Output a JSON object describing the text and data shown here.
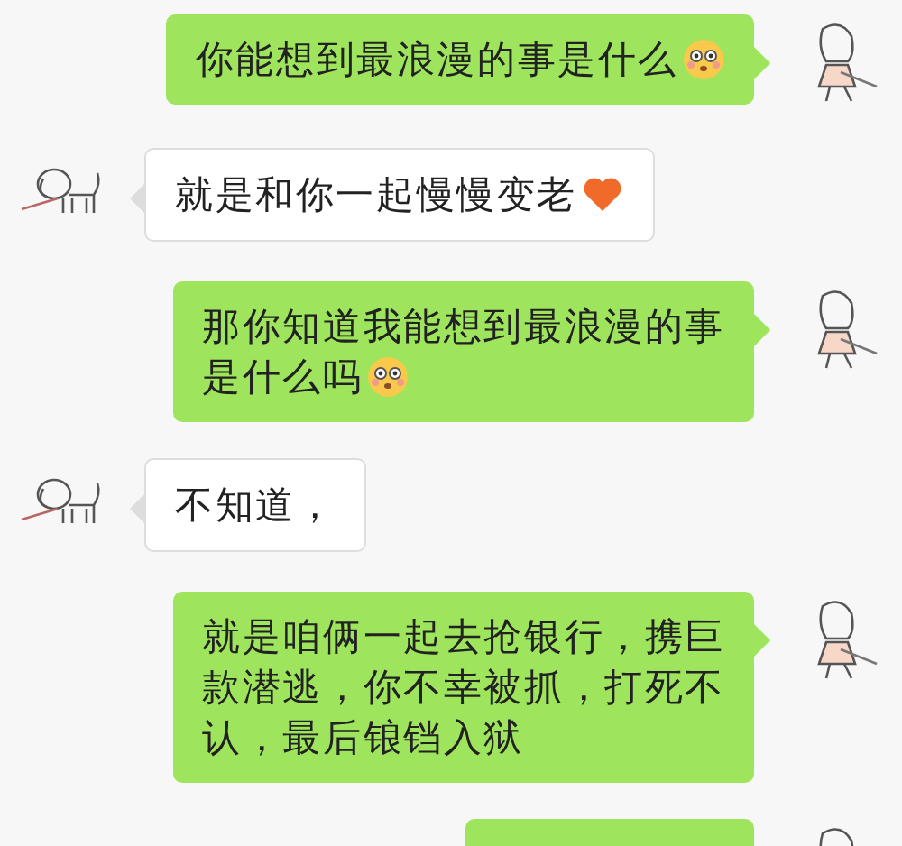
{
  "messages": [
    {
      "kind": "sent",
      "lines": [
        "你能想到最浪漫的事是什么"
      ],
      "emoji": {
        "kind": "flushed"
      }
    },
    {
      "kind": "received",
      "lines": [
        "就是和你一起慢慢变老"
      ],
      "emoji": {
        "kind": "heart"
      }
    },
    {
      "kind": "sent",
      "lines": [
        "那你知道我能想到最浪漫的事",
        "是什么吗"
      ],
      "emoji": {
        "kind": "flushed"
      }
    },
    {
      "kind": "received",
      "lines": [
        "不知道，"
      ]
    },
    {
      "kind": "sent",
      "lines": [
        "就是咱俩一起去抢银行，携巨",
        "款潜逃，你不幸被抓，打死不",
        "认，最后锒铛入狱"
      ]
    },
    {
      "kind": "sent"
    }
  ]
}
